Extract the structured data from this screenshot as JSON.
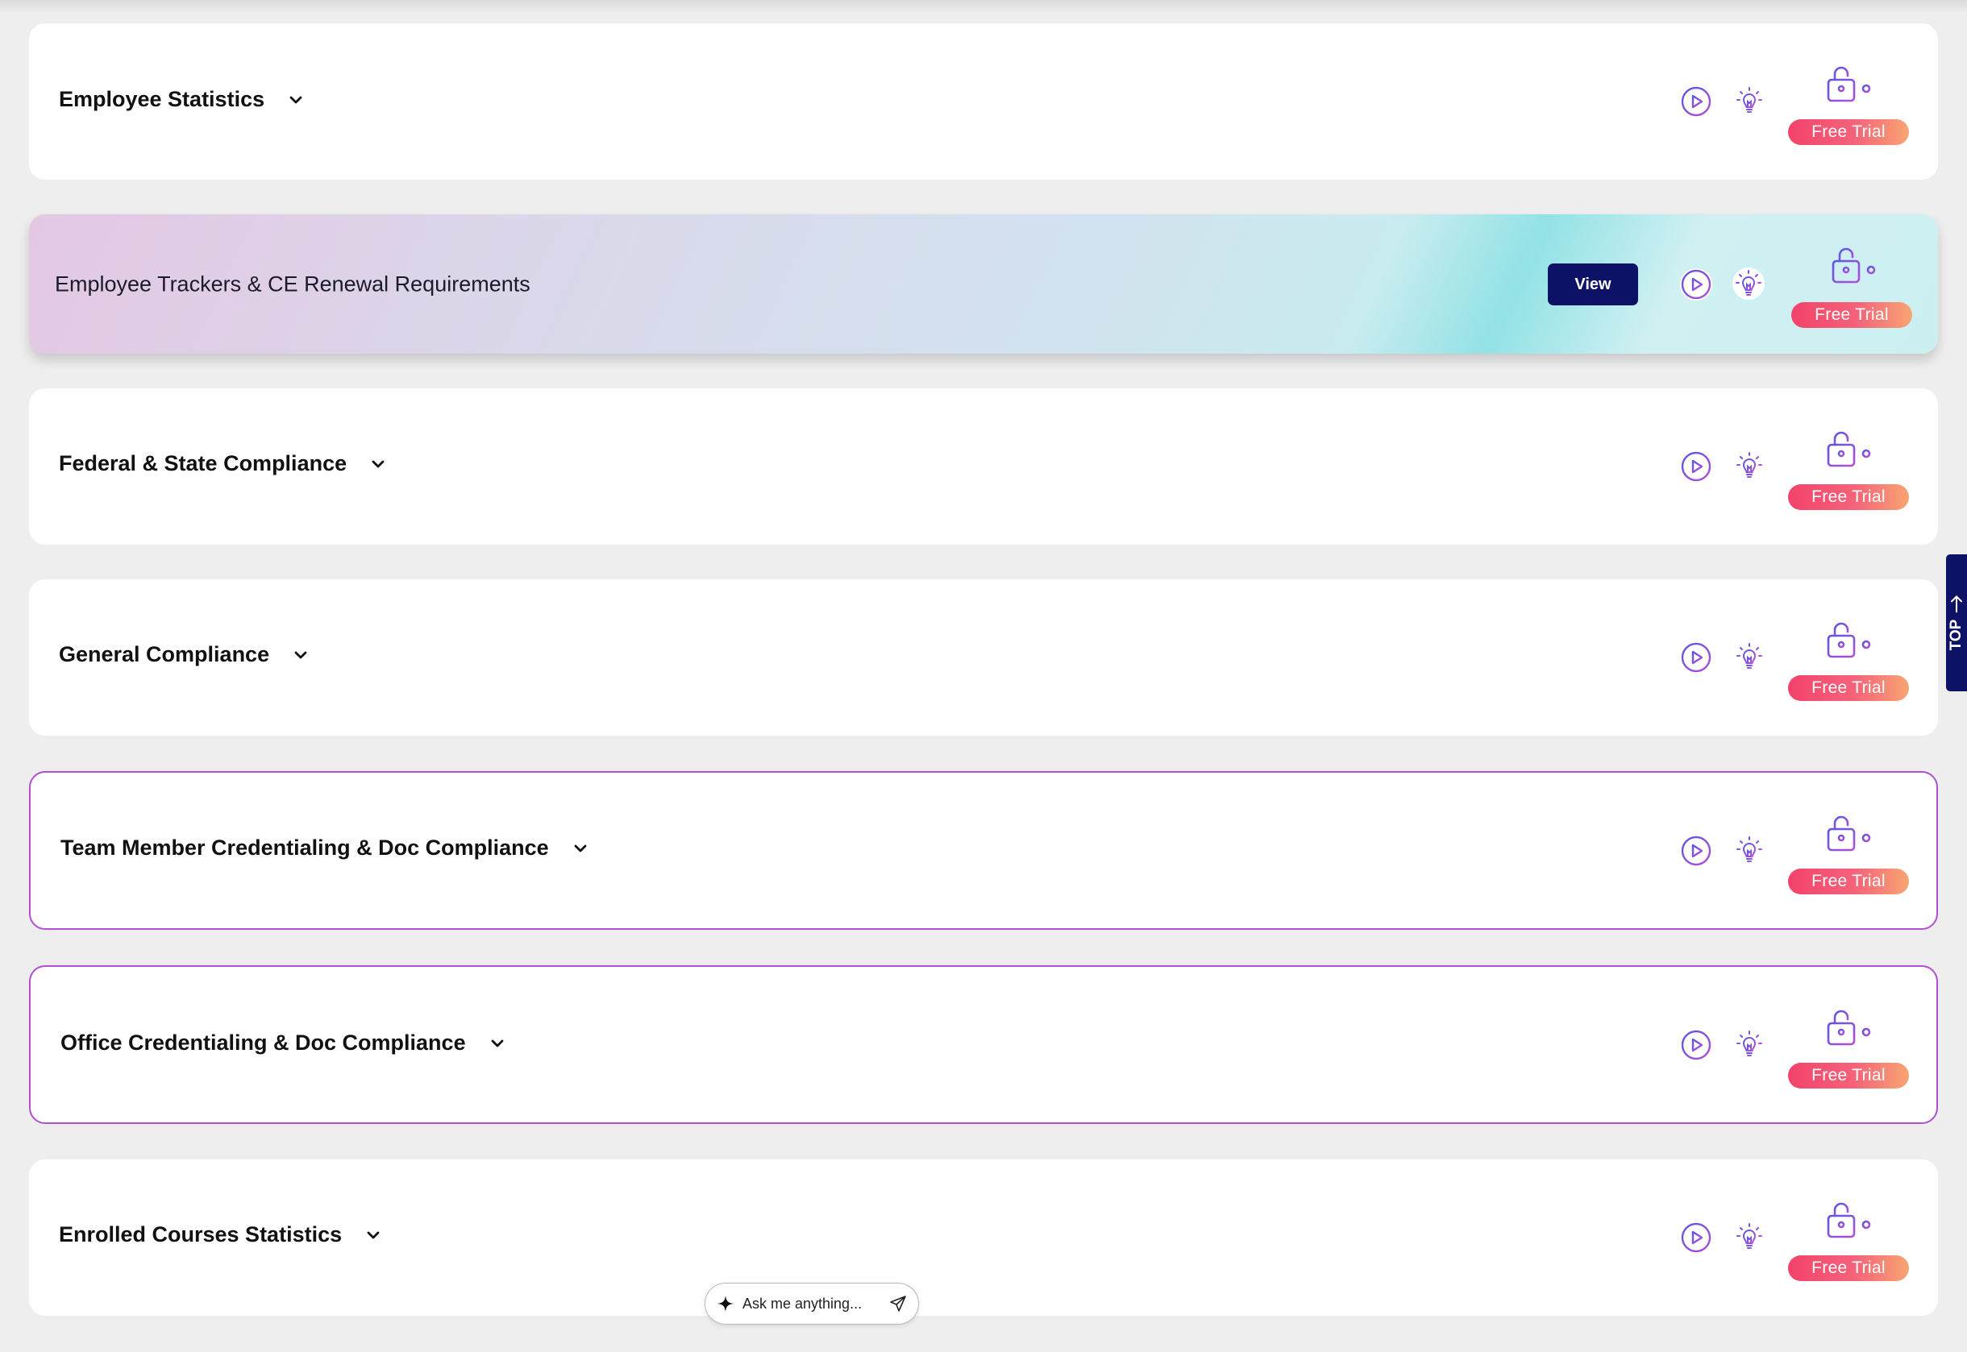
{
  "cards": [
    {
      "title": "Employee Statistics",
      "trial_label": "Free Trial"
    },
    {
      "title": "Employee Trackers & CE Renewal Requirements",
      "view_label": "View",
      "trial_label": "Free Trial"
    },
    {
      "title": "Federal & State Compliance",
      "trial_label": "Free Trial"
    },
    {
      "title": "General Compliance",
      "trial_label": "Free Trial"
    },
    {
      "title": "Team Member Credentialing & Doc Compliance",
      "trial_label": "Free Trial"
    },
    {
      "title": "Office Credentialing & Doc Compliance",
      "trial_label": "Free Trial"
    },
    {
      "title": "Enrolled Courses Statistics",
      "trial_label": "Free Trial"
    }
  ],
  "scroll_top_label": "TOP",
  "assistant": {
    "placeholder": "Ask me anything..."
  },
  "colors": {
    "accent_navy": "#0d1266",
    "icon_purple": "#8a4fe0",
    "card_border": "#b04fd0",
    "trial_gradient_start": "#f3426a",
    "trial_gradient_end": "#f8a572"
  },
  "icons": [
    "chevron-down-icon",
    "play-icon",
    "lightbulb-icon",
    "lock-icon",
    "sparkle-icon",
    "send-icon",
    "arrow-up-icon"
  ]
}
